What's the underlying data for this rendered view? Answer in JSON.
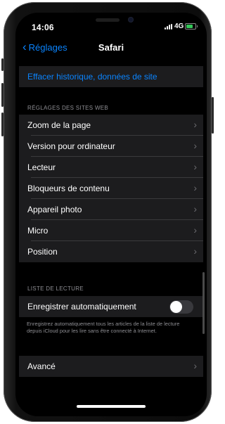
{
  "status_bar": {
    "time": "14:06",
    "network": "4G"
  },
  "nav": {
    "back_label": "Réglages",
    "title": "Safari"
  },
  "clear_history_label": "Effacer historique, données de site",
  "websites_section": {
    "header": "RÉGLAGES DES SITES WEB",
    "items": [
      {
        "label": "Zoom de la page"
      },
      {
        "label": "Version pour ordinateur"
      },
      {
        "label": "Lecteur"
      },
      {
        "label": "Bloqueurs de contenu"
      },
      {
        "label": "Appareil photo"
      },
      {
        "label": "Micro"
      },
      {
        "label": "Position"
      }
    ]
  },
  "reading_list": {
    "header": "LISTE DE LECTURE",
    "auto_save_label": "Enregistrer automatiquement",
    "auto_save_on": false,
    "footer": "Enregistrez automatiquement tous les articles de la liste de lecture depuis iCloud pour les lire sans être connecté à Internet."
  },
  "advanced_label": "Avancé",
  "colors": {
    "accent": "#0a84ff",
    "background": "#000000",
    "cell": "#1c1c1e"
  }
}
